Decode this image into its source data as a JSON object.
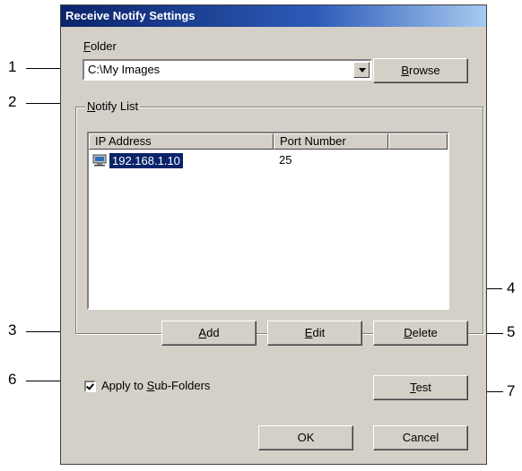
{
  "dialog": {
    "title": "Receive Notify Settings",
    "folder_label_hotkey": "F",
    "folder_label_rest": "older",
    "folder_value": "C:\\My Images",
    "browse_hotkey": "B",
    "browse_rest": "rowse",
    "notify_hotkey": "N",
    "notify_rest": "otify List",
    "columns": [
      "IP Address",
      "Port Number"
    ],
    "rows": [
      {
        "ip": "192.168.1.10",
        "port": "25"
      }
    ],
    "add_hotkey": "A",
    "add_rest": "dd",
    "edit_hotkey": "E",
    "edit_rest": "dit",
    "delete_hotkey": "D",
    "delete_rest": "elete",
    "apply_pre": "Apply to ",
    "apply_hotkey": "S",
    "apply_rest": "ub-Folders",
    "apply_checked": true,
    "test_hotkey": "T",
    "test_rest": "est",
    "ok_label": "OK",
    "cancel_label": "Cancel"
  },
  "callouts": [
    "1",
    "2",
    "3",
    "4",
    "5",
    "6",
    "7"
  ]
}
